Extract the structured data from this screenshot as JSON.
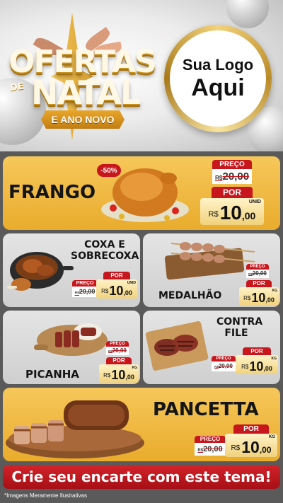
{
  "header": {
    "title_line1": "OFERTAS",
    "title_de": "DE",
    "title_line2": "NATAL",
    "subtitle": "E ANO NOVO",
    "logo_line1": "Sua Logo",
    "logo_line2": "Aqui"
  },
  "colors": {
    "accent_red": "#c8161d",
    "gold": "#e9ac2d",
    "panel_gray": "#d6d6d6"
  },
  "products": [
    {
      "name": "FRANGO",
      "discount": "-50%",
      "old_label": "PREÇO",
      "old_currency": "R$",
      "old_price": "20,00",
      "new_label": "POR",
      "currency": "R$",
      "price_int": "10",
      "price_dec": ",00",
      "unit": "UNID"
    },
    {
      "name_line1": "COXA E",
      "name_line2": "SOBRECOXA",
      "old_label": "PREÇO",
      "old_currency": "R$",
      "old_price": "20,00",
      "new_label": "POR",
      "currency": "R$",
      "price_int": "10",
      "price_dec": ",00",
      "unit": "UNID"
    },
    {
      "name": "MEDALHÃO",
      "old_label": "PREÇO",
      "old_currency": "R$",
      "old_price": "20,00",
      "new_label": "POR",
      "currency": "R$",
      "price_int": "10",
      "price_dec": ",00",
      "unit": "KG"
    },
    {
      "name": "PICANHA",
      "old_label": "PREÇO",
      "old_currency": "R$",
      "old_price": "20,00",
      "new_label": "POR",
      "currency": "R$",
      "price_int": "10",
      "price_dec": ",00",
      "unit": "KG"
    },
    {
      "name_line1": "CONTRA",
      "name_line2": "FILE",
      "old_label": "PREÇO",
      "old_currency": "R$",
      "old_price": "20,00",
      "new_label": "POR",
      "currency": "R$",
      "price_int": "10",
      "price_dec": ",00",
      "unit": "KG"
    },
    {
      "name": "PANCETTA",
      "old_label": "PREÇO",
      "old_currency": "R$",
      "old_price": "20,00",
      "new_label": "POR",
      "currency": "R$",
      "price_int": "10",
      "price_dec": ",00",
      "unit": "KG"
    }
  ],
  "cta": "Crie seu encarte com este tema!",
  "footnote": "*Imagens Meramente Ilustrativas"
}
